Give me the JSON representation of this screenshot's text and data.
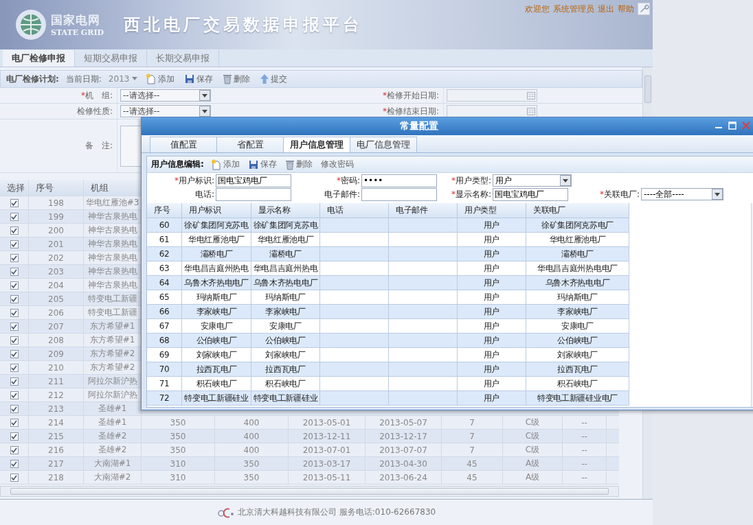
{
  "header": {
    "logo_cn": "国家电网",
    "logo_en": "STATE GRID",
    "title": "西北电厂交易数据申报平台",
    "greeting": "欢迎您",
    "links": [
      "系统管理员",
      "退出",
      "帮助"
    ]
  },
  "tabs": [
    {
      "label": "电厂检修申报",
      "selected": true
    },
    {
      "label": "短期交易申报",
      "selected": false
    },
    {
      "label": "长期交易申报",
      "selected": false
    }
  ],
  "plan_toolbar": {
    "title": "电厂检修计划:",
    "date_label": "当前日期:",
    "year": "2013",
    "actions": [
      {
        "kind": "add",
        "label": "添加"
      },
      {
        "kind": "save",
        "label": "保存"
      },
      {
        "kind": "delete",
        "label": "删除"
      },
      {
        "kind": "submit",
        "label": "提交"
      }
    ]
  },
  "plan_form": {
    "rows": [
      [
        {
          "kind": "select",
          "label": "机　组:",
          "mark": "*",
          "value": "--请选择--"
        },
        {
          "kind": "date",
          "label": "检修开始日期:",
          "mark": "*"
        }
      ],
      [
        {
          "kind": "select",
          "label": "检修性质:",
          "value": "--请选择--"
        },
        {
          "kind": "date",
          "label": "检修结束日期:",
          "mark": "*"
        }
      ],
      [
        {
          "kind": "textarea",
          "label": "备　注:"
        }
      ]
    ]
  },
  "plan_table": {
    "columns": [
      "选择",
      "序号",
      "机组"
    ],
    "rows": [
      {
        "checked": true,
        "seq": "198",
        "unit": "华电红雁池#3"
      },
      {
        "checked": true,
        "seq": "199",
        "unit": "神华古泉热电"
      },
      {
        "checked": true,
        "seq": "200",
        "unit": "神华古泉热电"
      },
      {
        "checked": true,
        "seq": "201",
        "unit": "神华古泉热电"
      },
      {
        "checked": true,
        "seq": "202",
        "unit": "神华古泉热电"
      },
      {
        "checked": true,
        "seq": "203",
        "unit": "神华古泉热电"
      },
      {
        "checked": true,
        "seq": "204",
        "unit": "神华古泉热电"
      },
      {
        "checked": true,
        "seq": "205",
        "unit": "特变电工新疆"
      },
      {
        "checked": true,
        "seq": "206",
        "unit": "特变电工新疆"
      },
      {
        "checked": true,
        "seq": "207",
        "unit": "东方希望#1"
      },
      {
        "checked": true,
        "seq": "208",
        "unit": "东方希望#1"
      },
      {
        "checked": true,
        "seq": "209",
        "unit": "东方希望#2"
      },
      {
        "checked": true,
        "seq": "210",
        "unit": "东方希望#2"
      },
      {
        "checked": true,
        "seq": "211",
        "unit": "阿拉尔新沪热"
      },
      {
        "checked": true,
        "seq": "212",
        "unit": "阿拉尔新沪热"
      },
      {
        "checked": true,
        "seq": "213",
        "unit": "圣雄#1"
      },
      {
        "checked": true,
        "seq": "214",
        "unit": "圣雄#1",
        "cells": [
          "350",
          "400",
          "2013-05-01",
          "2013-05-07",
          "7",
          "C级",
          "--"
        ]
      },
      {
        "checked": true,
        "seq": "215",
        "unit": "圣雄#2",
        "cells": [
          "350",
          "400",
          "2013-12-11",
          "2013-12-17",
          "7",
          "C级",
          "--"
        ]
      },
      {
        "checked": true,
        "seq": "216",
        "unit": "圣雄#2",
        "cells": [
          "350",
          "400",
          "2013-07-01",
          "2013-07-07",
          "7",
          "C级",
          "--"
        ]
      },
      {
        "checked": true,
        "seq": "217",
        "unit": "大南湖#1",
        "cells": [
          "310",
          "350",
          "2013-03-17",
          "2013-04-30",
          "45",
          "A级",
          "--"
        ]
      },
      {
        "checked": true,
        "seq": "218",
        "unit": "大南湖#2",
        "cells": [
          "310",
          "350",
          "2013-05-11",
          "2013-06-24",
          "45",
          "A级",
          "--"
        ]
      }
    ]
  },
  "footer": {
    "company": "北京清大科越科技有限公司",
    "service": "服务电话:010-62667830"
  },
  "dialog": {
    "title": "常量配置",
    "tabs": [
      {
        "label": "值配置",
        "selected": false
      },
      {
        "label": "省配置",
        "selected": false
      },
      {
        "label": "用户信息管理",
        "selected": true
      },
      {
        "label": "电厂信息管理",
        "selected": false
      }
    ],
    "toolbar": {
      "title": "用户信息编辑:",
      "actions": [
        {
          "kind": "add",
          "label": "添加"
        },
        {
          "kind": "save",
          "label": "保存"
        },
        {
          "kind": "delete",
          "label": "删除"
        },
        {
          "kind": "text",
          "label": "修改密码"
        }
      ]
    },
    "form": {
      "rows": [
        [
          {
            "kind": "text",
            "label": "用户标识:",
            "mark": "*",
            "value": "国电宝鸡电厂"
          },
          {
            "kind": "password",
            "label": "密码:",
            "mark": "*",
            "value": "••••"
          },
          {
            "kind": "select",
            "label": "用户类型:",
            "mark": "*",
            "value": "用户"
          }
        ],
        [
          {
            "kind": "text",
            "label": "电话:"
          },
          {
            "kind": "text",
            "label": "电子邮件:"
          },
          {
            "kind": "text",
            "label": "显示名称:",
            "mark": "*",
            "value": "国电宝鸡电厂"
          },
          {
            "kind": "select",
            "label": "关联电厂:",
            "mark": "*",
            "value": "----全部----"
          }
        ]
      ]
    },
    "grid": {
      "columns": [
        "序号",
        "用户标识",
        "显示名称",
        "电话",
        "电子邮件",
        "用户类型",
        "关联电厂"
      ],
      "rows": [
        {
          "seq": "60",
          "user_id": "徐矿集团阿克苏电",
          "display_name": "徐矿集团阿克苏电",
          "user_type": "用户",
          "plant": "徐矿集团阿克苏电厂"
        },
        {
          "seq": "61",
          "user_id": "华电红雁池电厂",
          "display_name": "华电红雁池电厂",
          "user_type": "用户",
          "plant": "华电红雁池电厂"
        },
        {
          "seq": "62",
          "user_id": "灞桥电厂",
          "display_name": "灞桥电厂",
          "user_type": "用户",
          "plant": "灞桥电厂"
        },
        {
          "seq": "63",
          "user_id": "华电昌吉庭州热电",
          "display_name": "华电昌吉庭州热电",
          "user_type": "用户",
          "plant": "华电昌吉庭州热电电厂"
        },
        {
          "seq": "64",
          "user_id": "乌鲁木齐热电电厂",
          "display_name": "乌鲁木齐热电电厂",
          "user_type": "用户",
          "plant": "乌鲁木齐热电电厂"
        },
        {
          "seq": "65",
          "user_id": "玛纳斯电厂",
          "display_name": "玛纳斯电厂",
          "user_type": "用户",
          "plant": "玛纳斯电厂"
        },
        {
          "seq": "66",
          "user_id": "李家峡电厂",
          "display_name": "李家峡电厂",
          "user_type": "用户",
          "plant": "李家峡电厂"
        },
        {
          "seq": "67",
          "user_id": "安康电厂",
          "display_name": "安康电厂",
          "user_type": "用户",
          "plant": "安康电厂"
        },
        {
          "seq": "68",
          "user_id": "公伯峡电厂",
          "display_name": "公伯峡电厂",
          "user_type": "用户",
          "plant": "公伯峡电厂"
        },
        {
          "seq": "69",
          "user_id": "刘家峡电厂",
          "display_name": "刘家峡电厂",
          "user_type": "用户",
          "plant": "刘家峡电厂"
        },
        {
          "seq": "70",
          "user_id": "拉西瓦电厂",
          "display_name": "拉西瓦电厂",
          "user_type": "用户",
          "plant": "拉西瓦电厂"
        },
        {
          "seq": "71",
          "user_id": "积石峡电厂",
          "display_name": "积石峡电厂",
          "user_type": "用户",
          "plant": "积石峡电厂"
        },
        {
          "seq": "72",
          "user_id": "特变电工新疆硅业",
          "display_name": "特变电工新疆硅业",
          "user_type": "用户",
          "plant": "特变电工新疆硅业电厂"
        }
      ]
    }
  }
}
